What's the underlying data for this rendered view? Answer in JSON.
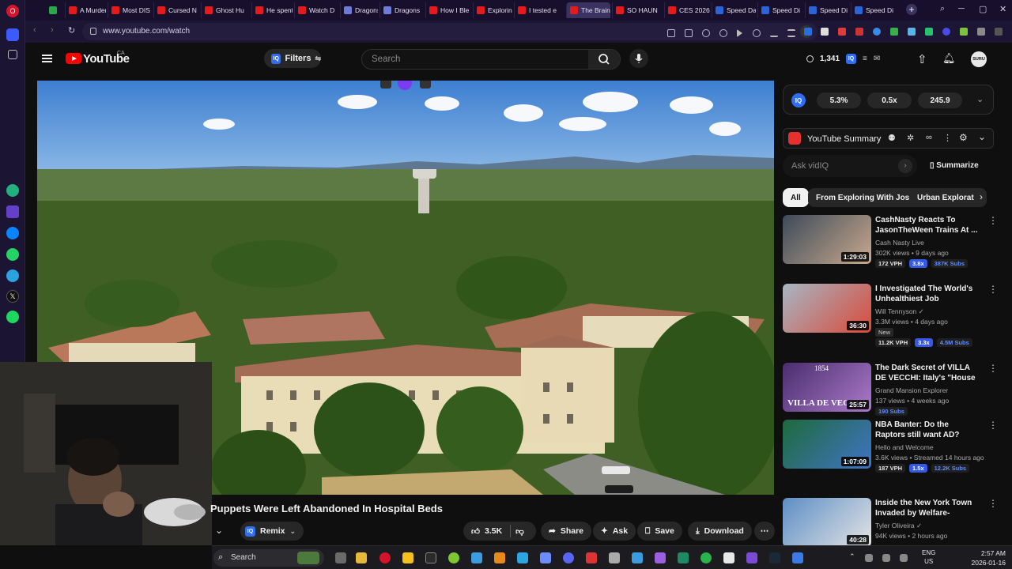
{
  "browser": {
    "tabs": [
      {
        "label": "A Murder",
        "icon": "youtube"
      },
      {
        "label": "Most DIS",
        "icon": "youtube"
      },
      {
        "label": "Cursed N",
        "icon": "youtube"
      },
      {
        "label": "Ghost Hu",
        "icon": "youtube"
      },
      {
        "label": "He spent",
        "icon": "youtube"
      },
      {
        "label": "Watch D",
        "icon": "youtube"
      },
      {
        "label": "Dragons",
        "icon": "generic"
      },
      {
        "label": "Dragons",
        "icon": "generic"
      },
      {
        "label": "How I Ble",
        "icon": "youtube"
      },
      {
        "label": "Exploring",
        "icon": "youtube"
      },
      {
        "label": "I tested e",
        "icon": "youtube"
      },
      {
        "label": "The Brain de",
        "icon": "youtube"
      },
      {
        "label": "SO HAUN",
        "icon": "youtube"
      },
      {
        "label": "CES 2026",
        "icon": "youtube"
      },
      {
        "label": "Speed Da",
        "icon": "generic"
      },
      {
        "label": "Speed Di",
        "icon": "generic"
      },
      {
        "label": "Speed Di",
        "icon": "generic"
      },
      {
        "label": "Speed Di",
        "icon": "generic"
      }
    ],
    "url": "www.youtube.com/watch"
  },
  "youtube": {
    "logo_text": "YouTube",
    "region": "CA",
    "filters_label": "Filters",
    "search_placeholder": "Search",
    "header_count": "1,341",
    "avatar_label": "SURU"
  },
  "video": {
    "title": "Puppets Were Left Abandoned In Hospital Beds",
    "remix_label": "Remix",
    "likes": "3.5K",
    "share_label": "Share",
    "ask_label": "Ask",
    "save_label": "Save",
    "download_label": "Download"
  },
  "vidiq": {
    "metrics": [
      "5.3%",
      "0.5x",
      "245.9"
    ],
    "summary_label": "YouTube Summary",
    "ask_placeholder": "Ask vidIQ",
    "summarize_label": "Summarize"
  },
  "chips": [
    "All",
    "From Exploring With Josh",
    "Urban Explorat"
  ],
  "recommendations": [
    {
      "title": "CashNasty Reacts To JasonTheWeen Trains At ...",
      "channel": "Cash Nasty Live",
      "meta": "302K views • 9 days ago",
      "duration": "1:29:03",
      "tags": [
        "172 VPH",
        "3.8x",
        "387K Subs"
      ],
      "verified": false
    },
    {
      "title": "I Investigated The World's Unhealthiest Job",
      "channel": "Will Tennyson",
      "meta": "3.3M views • 4 days ago",
      "duration": "36:30",
      "badge": "New",
      "tags": [
        "11.2K VPH",
        "3.3x",
        "4.5M Subs"
      ],
      "verified": true
    },
    {
      "title": "The Dark Secret of VILLA DE VECCHI: Italy's \"House of ...",
      "channel": "Grand Mansion Explorer",
      "meta": "137 views • 4 weeks ago",
      "duration": "25:57",
      "tags": [
        "190 Subs"
      ],
      "verified": false,
      "thumb_text": "VILLA DE VECCHI",
      "thumb_year": "1854"
    },
    {
      "title": "NBA Banter: Do the Raptors still want AD? Luka vs Dennis, Spu...",
      "channel": "Hello and Welcome",
      "meta": "3.6K views • Streamed 14 hours ago",
      "duration": "1:07:09",
      "tags": [
        "187 VPH",
        "1.5x",
        "12.2K Subs"
      ],
      "verified": false
    },
    {
      "title": "Inside the New York Town Invaded by Welfare-Addicted ...",
      "channel": "Tyler Oliveira",
      "meta": "94K views • 2 hours ago",
      "duration": "40:28",
      "tags": [],
      "verified": true
    }
  ],
  "taskbar": {
    "search_label": "Search",
    "lang": "ENG",
    "region": "US",
    "time": "2:57 AM",
    "date": "2026-01-16"
  },
  "colors": {
    "yt_red": "#ff0000",
    "vidiq_blue": "#2f6df5",
    "opera_bg": "#1b1533"
  }
}
